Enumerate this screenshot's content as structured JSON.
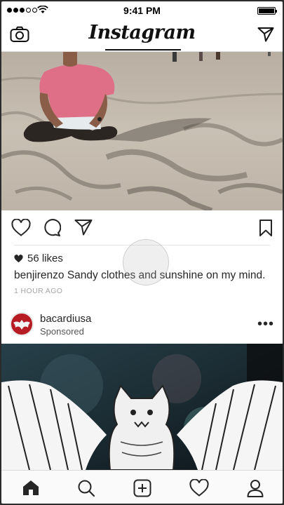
{
  "status_bar": {
    "time": "9:41 PM",
    "signal_bars": 3
  },
  "header": {
    "title": "Instagram"
  },
  "post": {
    "likes_text": "56 likes",
    "username": "benjirenzo",
    "caption": "Sandy clothes and sunshine on my mind.",
    "time_ago": "1 HOUR AGO"
  },
  "sponsored_post": {
    "username": "bacardiusa",
    "label": "Sponsored",
    "more": "•••"
  },
  "icons": {
    "header": [
      "camera-icon",
      "direct-send-icon"
    ],
    "actions": [
      "heart-icon",
      "comment-icon",
      "share-icon",
      "bookmark-icon"
    ],
    "tabs": [
      "home-icon",
      "search-icon",
      "add-post-icon",
      "activity-heart-icon",
      "profile-icon"
    ]
  },
  "colors": {
    "accent": "#262626",
    "brand_red": "#b71b24",
    "meta_gray": "#a5a5a5"
  }
}
